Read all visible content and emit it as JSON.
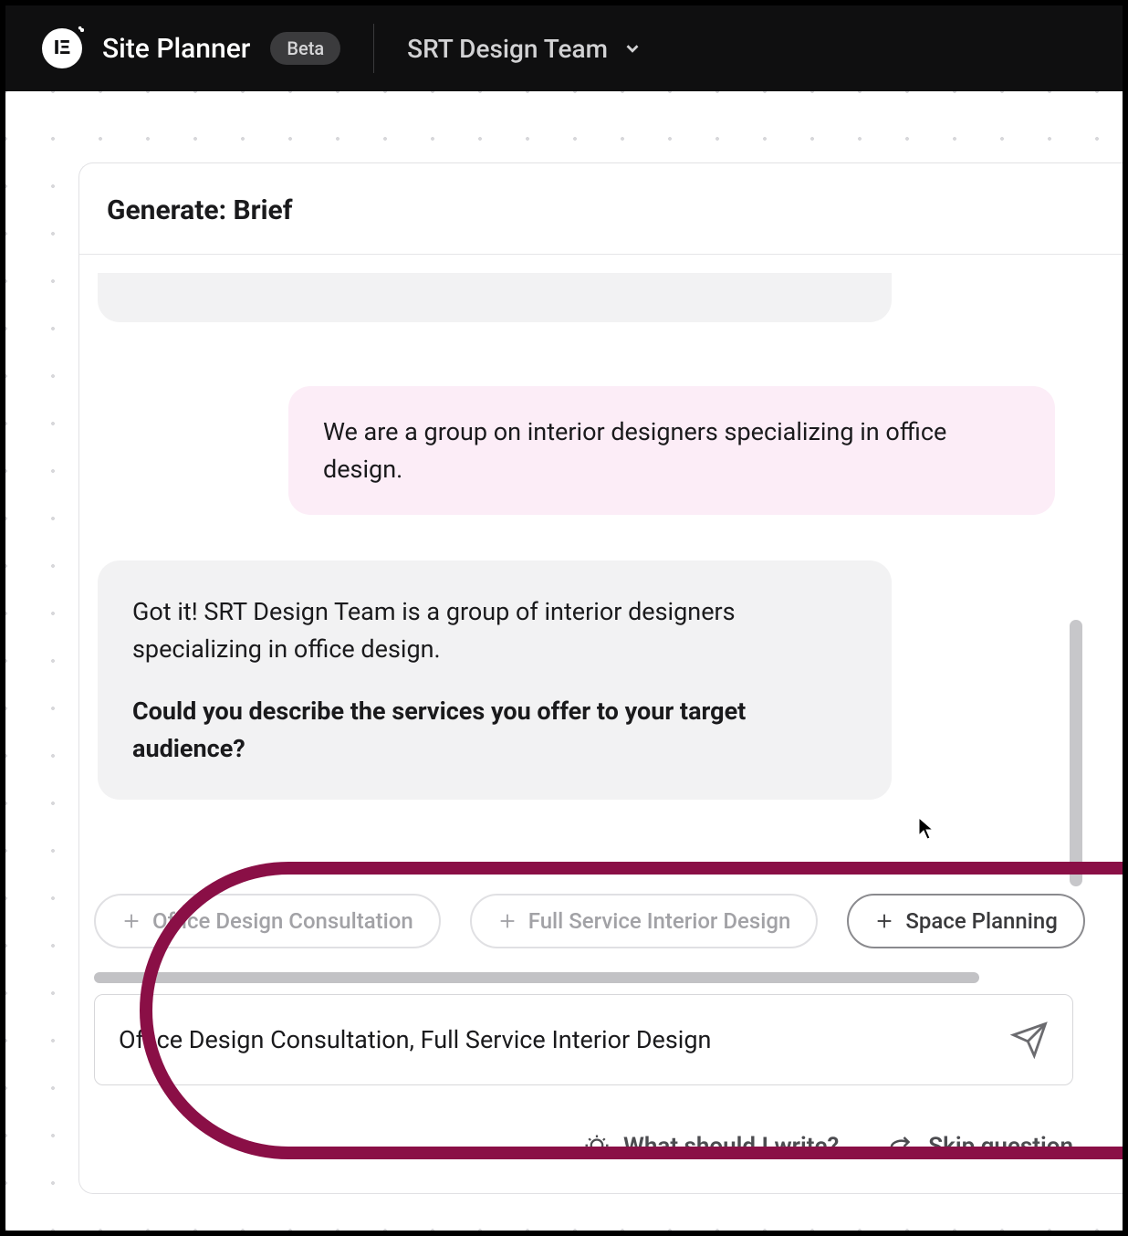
{
  "header": {
    "app_title": "Site Planner",
    "badge": "Beta",
    "team_name": "SRT Design Team"
  },
  "panel": {
    "title": "Generate: Brief"
  },
  "chat": {
    "user_msg": "We are a group on interior designers specializing in office design.",
    "ai_msg_1": "Got it! SRT Design Team is a group of interior designers specializing in office design.",
    "ai_msg_2": "Could you describe the services you offer to your target audience?"
  },
  "chips": [
    "Office Design Consultation",
    "Full Service Interior Design",
    "Space Planning"
  ],
  "input": {
    "value": "Office Design Consultation, Full Service Interior Design"
  },
  "footer": {
    "hint": "What should I write?",
    "skip": "Skip question"
  }
}
